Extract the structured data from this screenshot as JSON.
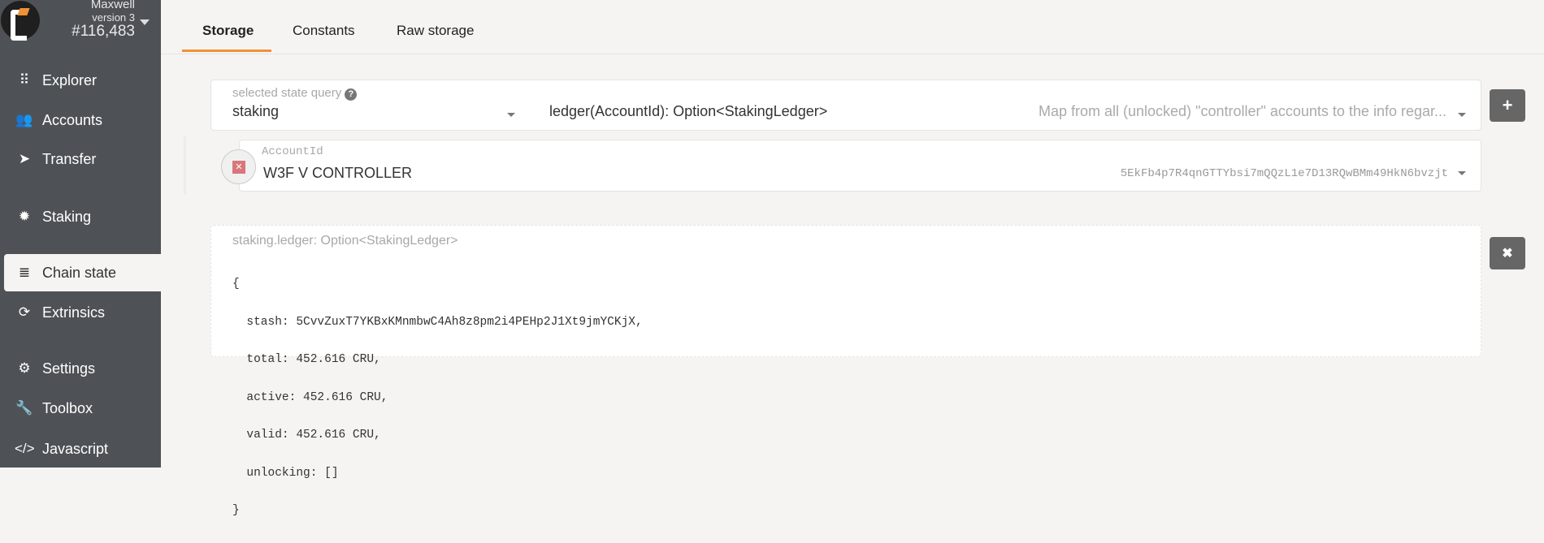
{
  "chain": {
    "name": "Maxwell",
    "version": "version 3",
    "block": "#116,483"
  },
  "sidebar": {
    "items": [
      {
        "label": "Explorer",
        "icon": "grid-icon"
      },
      {
        "label": "Accounts",
        "icon": "users-icon"
      },
      {
        "label": "Transfer",
        "icon": "paper-plane-icon"
      },
      {
        "label": "Staking",
        "icon": "certificate-icon"
      },
      {
        "label": "Chain state",
        "icon": "database-icon",
        "active": true
      },
      {
        "label": "Extrinsics",
        "icon": "sync-icon"
      },
      {
        "label": "Settings",
        "icon": "cogs-icon"
      },
      {
        "label": "Toolbox",
        "icon": "wrench-icon"
      },
      {
        "label": "Javascript",
        "icon": "code-icon"
      }
    ]
  },
  "tabs": [
    {
      "label": "Storage",
      "active": true
    },
    {
      "label": "Constants"
    },
    {
      "label": "Raw storage"
    }
  ],
  "query": {
    "label": "selected state query",
    "module": "staking",
    "method": "ledger(AccountId): Option<StakingLedger>",
    "description": "Map from all (unlocked) \"controller\" accounts to the info regar..."
  },
  "account": {
    "label": "AccountId",
    "name": "W3F V CONTROLLER",
    "address": "5EkFb4p7R4qnGTTYbsi7mQQzL1e7D13RQwBMm49HkN6bvzjt"
  },
  "result": {
    "title": "staking.ledger: Option<StakingLedger>",
    "lines": [
      "{",
      "  stash: 5CvvZuxT7YKBxKMnmbwC4Ah8z8pm2i4PEHp2J1Xt9jmYCKjX,",
      "  total: 452.616 CRU,",
      "  active: 452.616 CRU,",
      "  valid: 452.616 CRU,",
      "  unlocking: []",
      "}"
    ]
  },
  "buttons": {
    "add": "+",
    "remove": "✖"
  },
  "colors": {
    "accent": "#f19135",
    "sidebar": "#4e5256"
  }
}
